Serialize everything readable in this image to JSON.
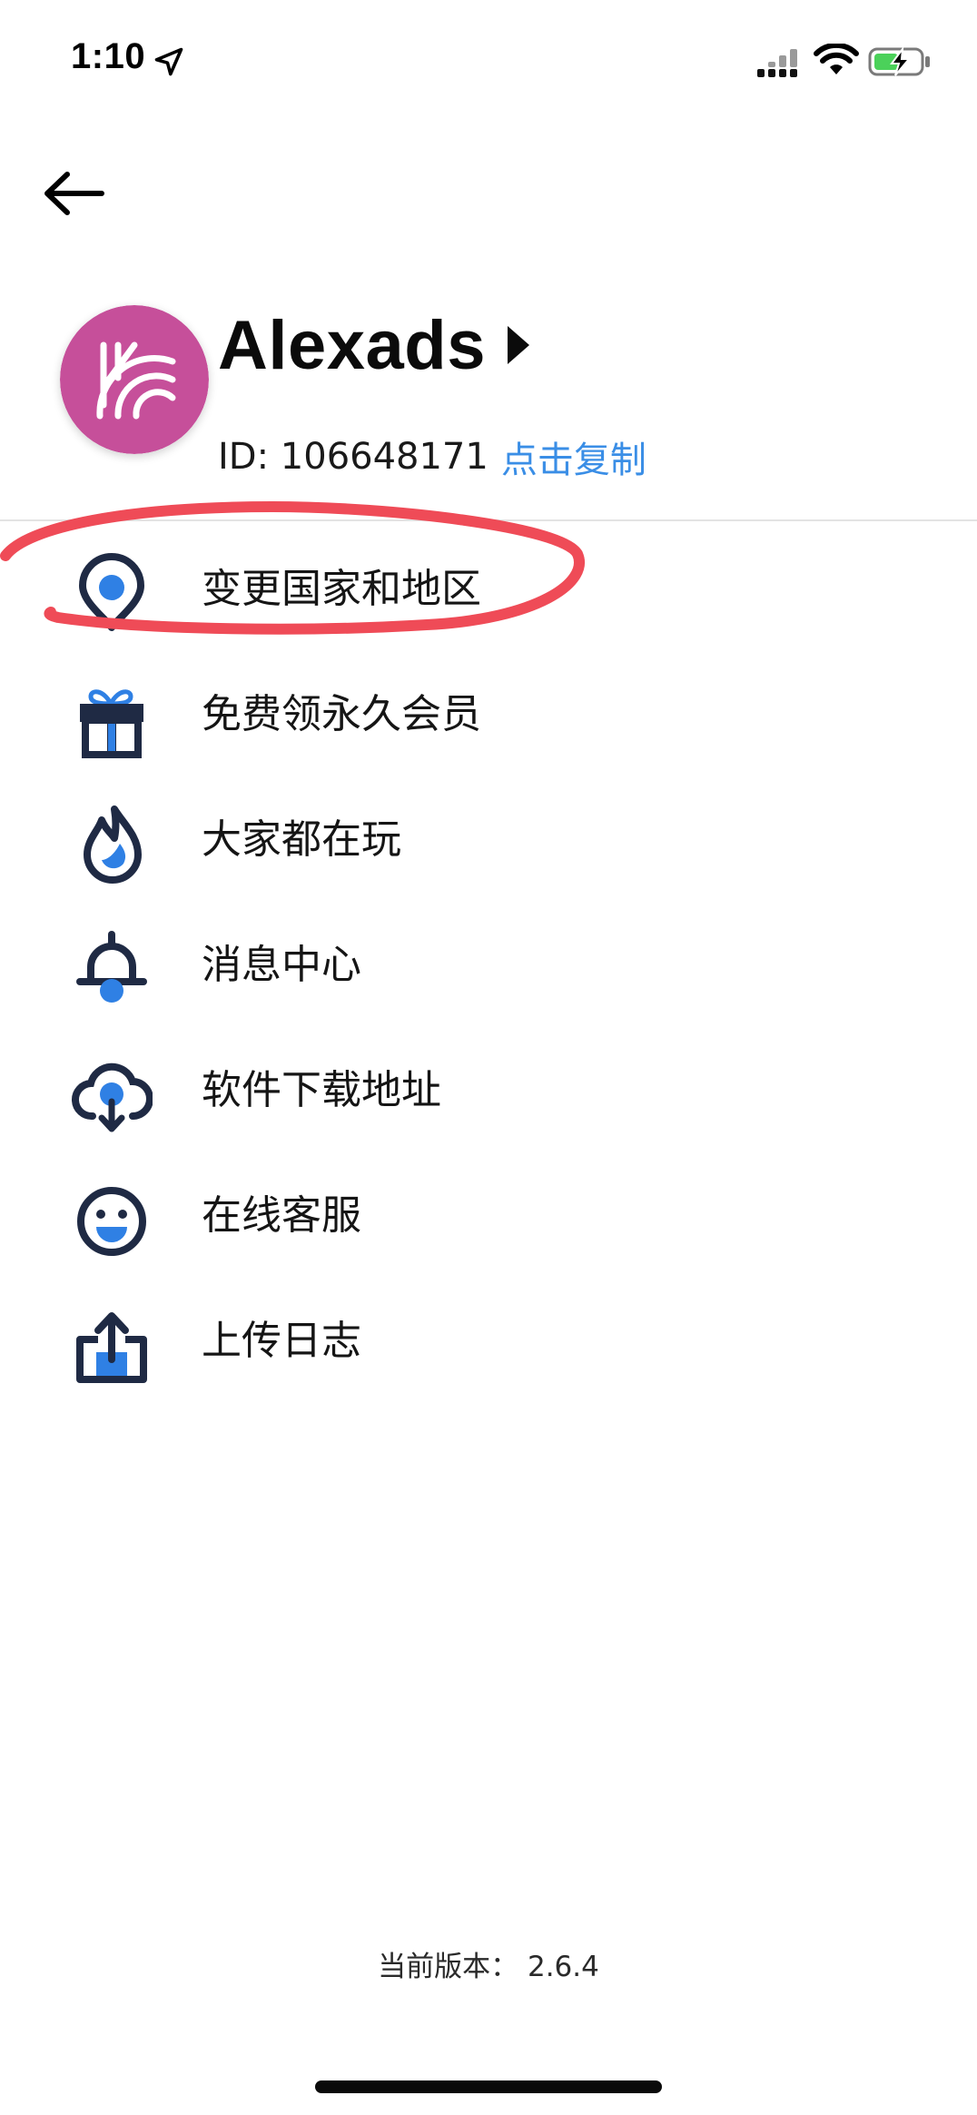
{
  "status_bar": {
    "time": "1:10",
    "icons": [
      "location-arrow-icon",
      "cellular-signal-icon",
      "wifi-icon",
      "battery-charging-icon"
    ]
  },
  "header": {
    "back_icon": "arrow-left-icon"
  },
  "profile": {
    "avatar_icon": "app-logo-icon",
    "avatar_color": "#c64f9a",
    "username": "Alexads",
    "id_text": "ID: 106648171",
    "copy_label": "点击复制",
    "link_color": "#3a8ee6"
  },
  "menu": {
    "items": [
      {
        "label": "变更国家和地区",
        "icon": "location-pin-icon"
      },
      {
        "label": "免费领永久会员",
        "icon": "gift-icon"
      },
      {
        "label": "大家都在玩",
        "icon": "flame-icon"
      },
      {
        "label": "消息中心",
        "icon": "bell-icon"
      },
      {
        "label": "软件下载地址",
        "icon": "cloud-download-icon"
      },
      {
        "label": "在线客服",
        "icon": "smiley-face-icon"
      },
      {
        "label": "上传日志",
        "icon": "upload-icon"
      }
    ]
  },
  "annotation": {
    "color": "#ef4b57"
  },
  "footer": {
    "version_text": "当前版本：  2.6.4"
  },
  "colors": {
    "icon_dark": "#1f2a44",
    "icon_accent": "#2f80e4"
  }
}
